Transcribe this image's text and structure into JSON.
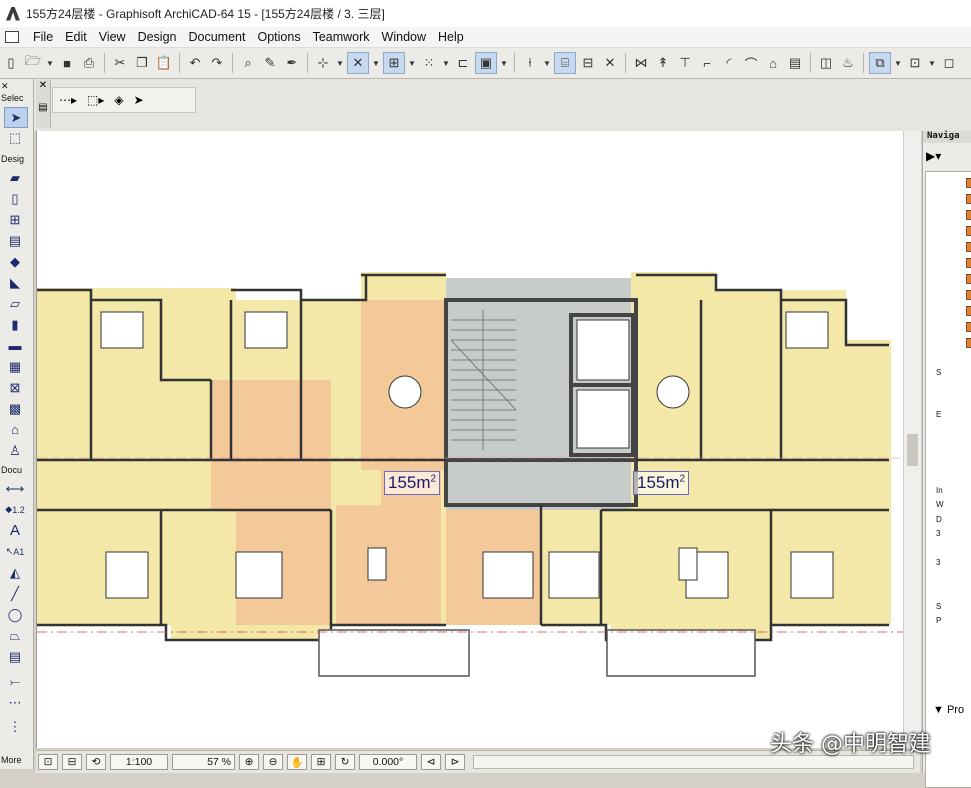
{
  "window": {
    "title": "155方24层楼 - Graphisoft ArchiCAD-64 15 - [155方24层楼 / 3. 三层]"
  },
  "menu": [
    "File",
    "Edit",
    "View",
    "Design",
    "Document",
    "Options",
    "Teamwork",
    "Window",
    "Help"
  ],
  "toolbox": {
    "header_select": "Selec",
    "header_design": "Desig",
    "header_document": "Docu",
    "more_label": "More",
    "dim_label_1": "1.2",
    "dim_label_2": "A1"
  },
  "navigator": {
    "title": "Naviga",
    "row_labels": [
      "S",
      "E",
      "In",
      "W",
      "D",
      "3",
      "3",
      "S",
      "P"
    ],
    "bottom_label": "Pro"
  },
  "floorplan": {
    "area_left": "155m",
    "area_right": "155m",
    "area_sup": "2"
  },
  "statusbar": {
    "scale": "1:100",
    "zoom": "57 %",
    "angle": "0.000°"
  },
  "watermark": "头条 @中明智建",
  "colors": {
    "yellow_room": "#f3e8a8",
    "orange_room": "#f4c99a",
    "core_gray": "#c8ccc8",
    "wall": "#444444"
  }
}
